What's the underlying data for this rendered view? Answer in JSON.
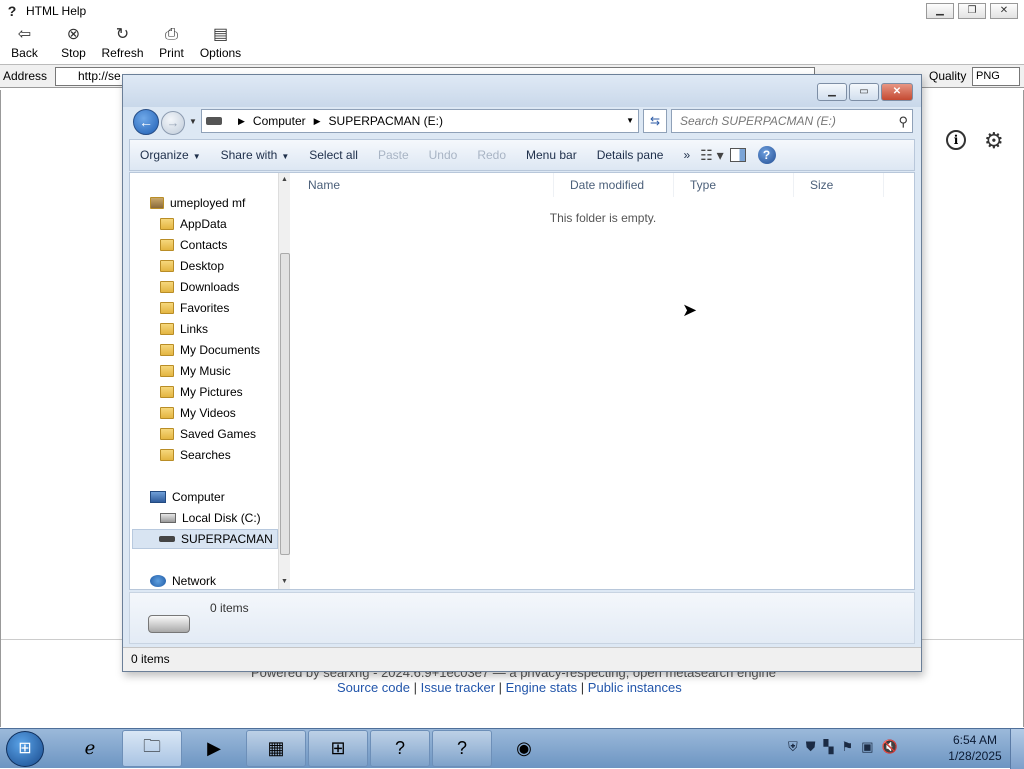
{
  "helpwin": {
    "title": "HTML Help",
    "toolbar": [
      {
        "label": "Back",
        "icon": "back-arrow-icon",
        "glyph": "⇦"
      },
      {
        "label": "Stop",
        "icon": "stop-icon",
        "glyph": "⊗"
      },
      {
        "label": "Refresh",
        "icon": "refresh-icon",
        "glyph": "↻"
      },
      {
        "label": "Print",
        "icon": "printer-icon",
        "glyph": "⎙"
      },
      {
        "label": "Options",
        "icon": "options-icon",
        "glyph": "▤"
      }
    ],
    "address_label": "Address",
    "address_value": "http://se",
    "quality_label": "Quality",
    "quality_value": "PNG",
    "footer_line1": "Powered by searxng - 2024.6.9+1ec03e7 — a privacy-respecting, open metasearch engine",
    "footer_links": [
      "Source code",
      "Issue tracker",
      "Engine stats",
      "Public instances"
    ],
    "footer_sep": " | "
  },
  "explorer": {
    "breadcrumb": [
      "Computer",
      "SUPERPACMAN (E:)"
    ],
    "search_placeholder": "Search SUPERPACMAN (E:)",
    "commands": {
      "organize": "Organize",
      "share": "Share with",
      "select_all": "Select all",
      "paste": "Paste",
      "undo": "Undo",
      "redo": "Redo",
      "menu_bar": "Menu bar",
      "details_pane": "Details pane",
      "more": "»"
    },
    "tree": {
      "user": "umeployed mf",
      "folders": [
        "AppData",
        "Contacts",
        "Desktop",
        "Downloads",
        "Favorites",
        "Links",
        "My Documents",
        "My Music",
        "My Pictures",
        "My Videos",
        "Saved Games",
        "Searches"
      ],
      "computer": "Computer",
      "local_disk": "Local Disk (C:)",
      "superpacman": "SUPERPACMAN",
      "network": "Network"
    },
    "columns": {
      "name": "Name",
      "date": "Date modified",
      "type": "Type",
      "size": "Size"
    },
    "empty_message": "This folder is empty.",
    "details_count": "0 items",
    "status_count": "0 items"
  },
  "taskbar": {
    "clock_time": "6:54 AM",
    "clock_date": "1/28/2025"
  }
}
